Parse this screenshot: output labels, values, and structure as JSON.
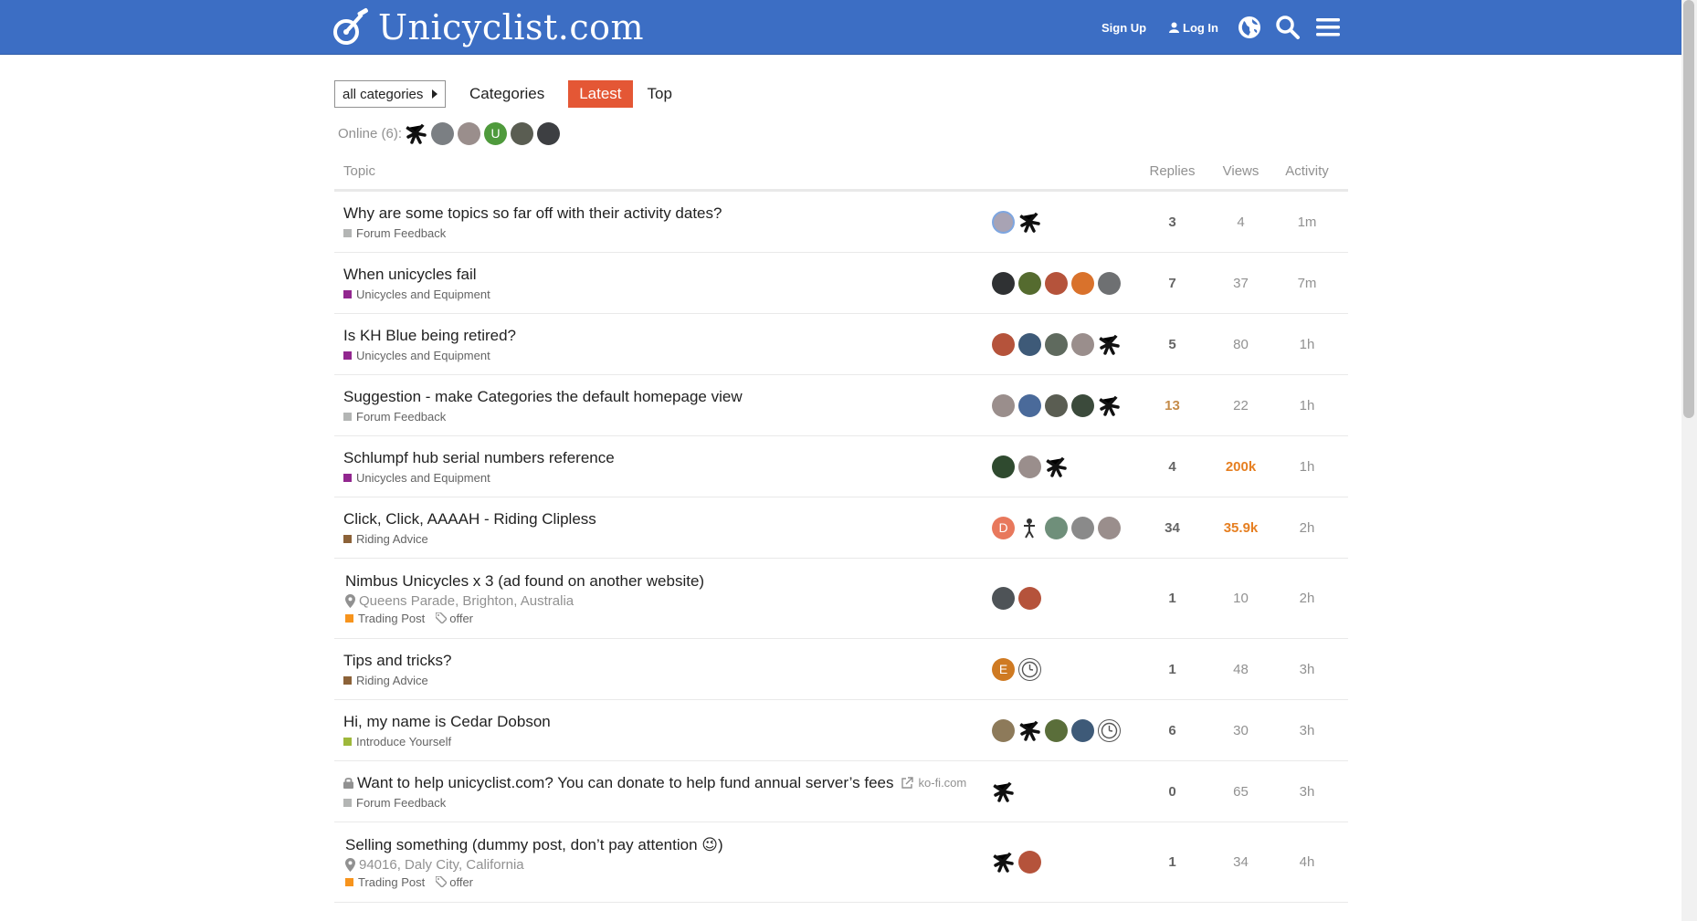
{
  "header": {
    "site_name": "Unicyclist.com",
    "signup_label": "Sign Up",
    "login_label": "Log In"
  },
  "nav": {
    "category_dropdown": "all categories",
    "tabs": [
      "Categories",
      "Latest",
      "Top"
    ],
    "active_tab": "Latest"
  },
  "online": {
    "label": "Online (6):"
  },
  "table": {
    "columns": {
      "topic": "Topic",
      "replies": "Replies",
      "views": "Views",
      "activity": "Activity"
    },
    "rows": [
      {
        "title": "Why are some topics so far off with their activity dates?",
        "category": "Forum Feedback",
        "category_color": "#b3b5b4",
        "replies": "3",
        "views": "4",
        "activity": "1m"
      },
      {
        "title": "When unicycles fail",
        "category": "Unicycles and Equipment",
        "category_color": "#92278f",
        "replies": "7",
        "views": "37",
        "activity": "7m"
      },
      {
        "title": "Is KH Blue being retired?",
        "category": "Unicycles and Equipment",
        "category_color": "#92278f",
        "replies": "5",
        "views": "80",
        "activity": "1h"
      },
      {
        "title": "Suggestion - make Categories the default homepage view",
        "category": "Forum Feedback",
        "category_color": "#b3b5b4",
        "replies": "13",
        "views": "22",
        "activity": "1h"
      },
      {
        "title": "Schlumpf hub serial numbers reference",
        "category": "Unicycles and Equipment",
        "category_color": "#92278f",
        "replies": "4",
        "views": "200k",
        "activity": "1h"
      },
      {
        "title": "Click, Click, AAAAH - Riding Clipless",
        "category": "Riding Advice",
        "category_color": "#8c6238",
        "replies": "34",
        "views": "35.9k",
        "activity": "2h"
      },
      {
        "title": "Nimbus Unicycles x 3 (ad found on another website)",
        "location": "Queens Parade, Brighton, Australia",
        "category": "Trading Post",
        "category_color": "#f7941d",
        "tag": "offer",
        "replies": "1",
        "views": "10",
        "activity": "2h"
      },
      {
        "title": "Tips and tricks?",
        "category": "Riding Advice",
        "category_color": "#8c6238",
        "replies": "1",
        "views": "48",
        "activity": "3h"
      },
      {
        "title": "Hi, my name is Cedar Dobson",
        "category": "Introduce Yourself",
        "category_color": "#9eb83b",
        "replies": "6",
        "views": "30",
        "activity": "3h"
      },
      {
        "title": "Want to help unicyclist.com? You can donate to help fund annual server’s fees",
        "external": "ko-fi.com",
        "category": "Forum Feedback",
        "category_color": "#b3b5b4",
        "replies": "0",
        "views": "65",
        "activity": "3h"
      },
      {
        "title": "Selling something (dummy post, don’t pay attention 😉)",
        "location": "94016, Daly City, California",
        "category": "Trading Post",
        "category_color": "#f7941d",
        "tag": "offer",
        "replies": "1",
        "views": "34",
        "activity": "4h"
      }
    ]
  },
  "colors": {
    "header_bg": "#3c6ec4",
    "active_tab": "#e45735",
    "hot_views": "#e67f21"
  },
  "avatar_letters": {
    "d": "D",
    "e": "E",
    "u": "U"
  }
}
